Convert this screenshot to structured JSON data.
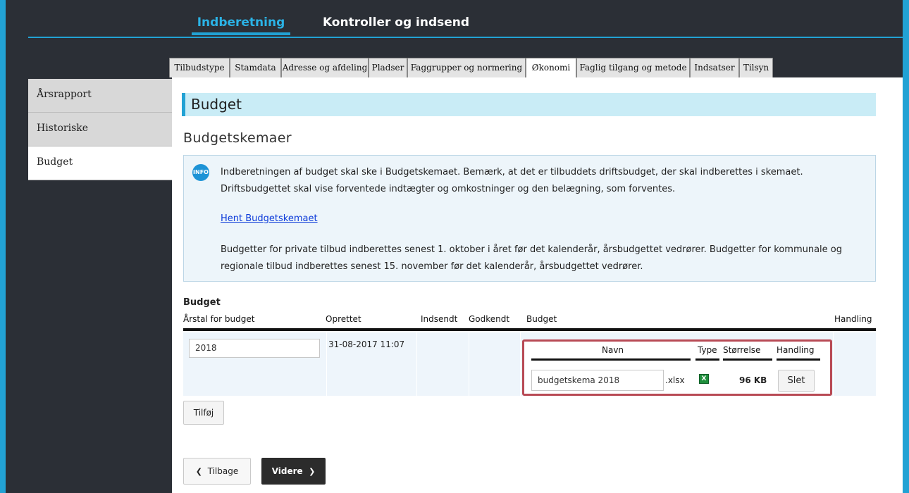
{
  "topnav": {
    "tabs": [
      {
        "label": "Indberetning",
        "active": true
      },
      {
        "label": "Kontroller og indsend",
        "active": false
      }
    ]
  },
  "subtabs": [
    {
      "label": "Tilbudstype",
      "active": false
    },
    {
      "label": "Stamdata",
      "active": false
    },
    {
      "label": "Adresse og afdeling",
      "active": false
    },
    {
      "label": "Pladser",
      "active": false
    },
    {
      "label": "Faggrupper og normering",
      "active": false
    },
    {
      "label": "Økonomi",
      "active": true
    },
    {
      "label": "Faglig tilgang og metode",
      "active": false
    },
    {
      "label": "Indsatser",
      "active": false
    },
    {
      "label": "Tilsyn",
      "active": false
    }
  ],
  "sidenav": {
    "items": [
      {
        "label": "Årsrapport",
        "active": false
      },
      {
        "label": "Historiske",
        "active": false
      },
      {
        "label": "Budget",
        "active": true
      }
    ]
  },
  "main": {
    "title": "Budget",
    "section_title": "Budgetskemaer",
    "info": {
      "icon_text": "INFO",
      "line1": "Indberetningen af budget skal ske i Budgetskemaet. Bemærk, at det er tilbuddets driftsbudget, der skal indberettes i skemaet.",
      "line2": "Driftsbudgettet skal vise forventede indtægter og omkostninger og den belægning, som forventes.",
      "link": "Hent Budgetskemaet",
      "line3": "Budgetter for private tilbud indberettes senest 1. oktober i året før det kalenderår, årsbudgettet vedrører. Budgetter for kommunale og",
      "line4": "regionale tilbud indberettes senest 15. november før det kalenderår, årsbudgettet vedrører."
    },
    "table": {
      "caption": "Budget",
      "headers": {
        "year": "Årstal for budget",
        "created": "Oprettet",
        "submitted": "Indsendt",
        "approved": "Godkendt",
        "budget": "Budget",
        "action": "Handling"
      },
      "rows": [
        {
          "year": "2018",
          "created": "31-08-2017 11:07",
          "submitted": "",
          "approved": "",
          "files": {
            "headers": {
              "name": "Navn",
              "type": "Type",
              "size": "Størrelse",
              "action": "Handling"
            },
            "items": [
              {
                "name": "budgetskema 2018",
                "ext": ".xlsx",
                "type_icon": "excel-file-icon",
                "size": "96 KB",
                "delete_label": "Slet"
              }
            ]
          }
        }
      ]
    },
    "add_label": "Tilføj",
    "back_label": "Tilbage",
    "next_label": "Videre"
  },
  "colors": {
    "accent": "#22a2d4",
    "title_bar": "#c9ecf6",
    "dark_bg": "#2b2f36",
    "highlight_border": "#b84a55"
  }
}
